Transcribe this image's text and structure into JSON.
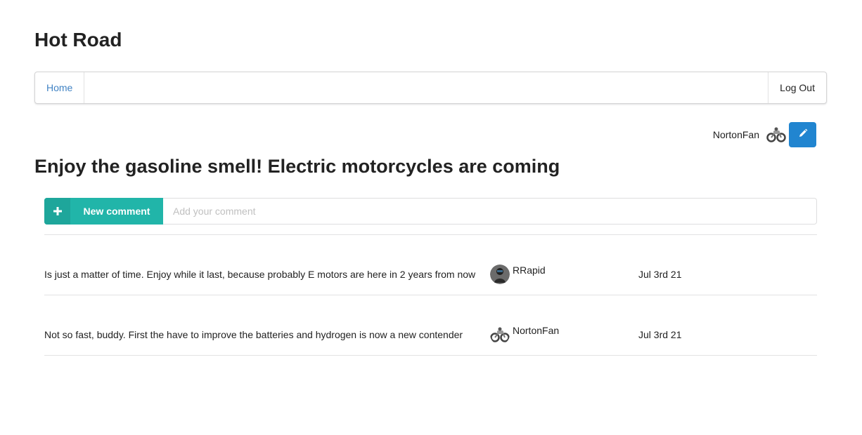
{
  "site": {
    "title": "Hot Road"
  },
  "nav": {
    "home": "Home",
    "logout": "Log Out"
  },
  "post": {
    "author": "NortonFan",
    "title": "Enjoy the gasoline smell! Electric motorcycles are coming"
  },
  "comment_form": {
    "button_label": "New comment",
    "placeholder": "Add your comment"
  },
  "comments": [
    {
      "text": "Is just a matter of time. Enjoy while it last, because probably E motors are here in 2 years from now",
      "author": "RRapid",
      "date": "Jul 3rd 21",
      "avatar_icon": "rider-avatar"
    },
    {
      "text": "Not so fast, buddy. First the have to improve the batteries and hydrogen is now a new contender",
      "author": "NortonFan",
      "date": "Jul 3rd 21",
      "avatar_icon": "motorcycle-avatar"
    }
  ],
  "colors": {
    "accent_blue": "#2185d0",
    "teal": "#21b5a9",
    "link": "#4183c4"
  }
}
